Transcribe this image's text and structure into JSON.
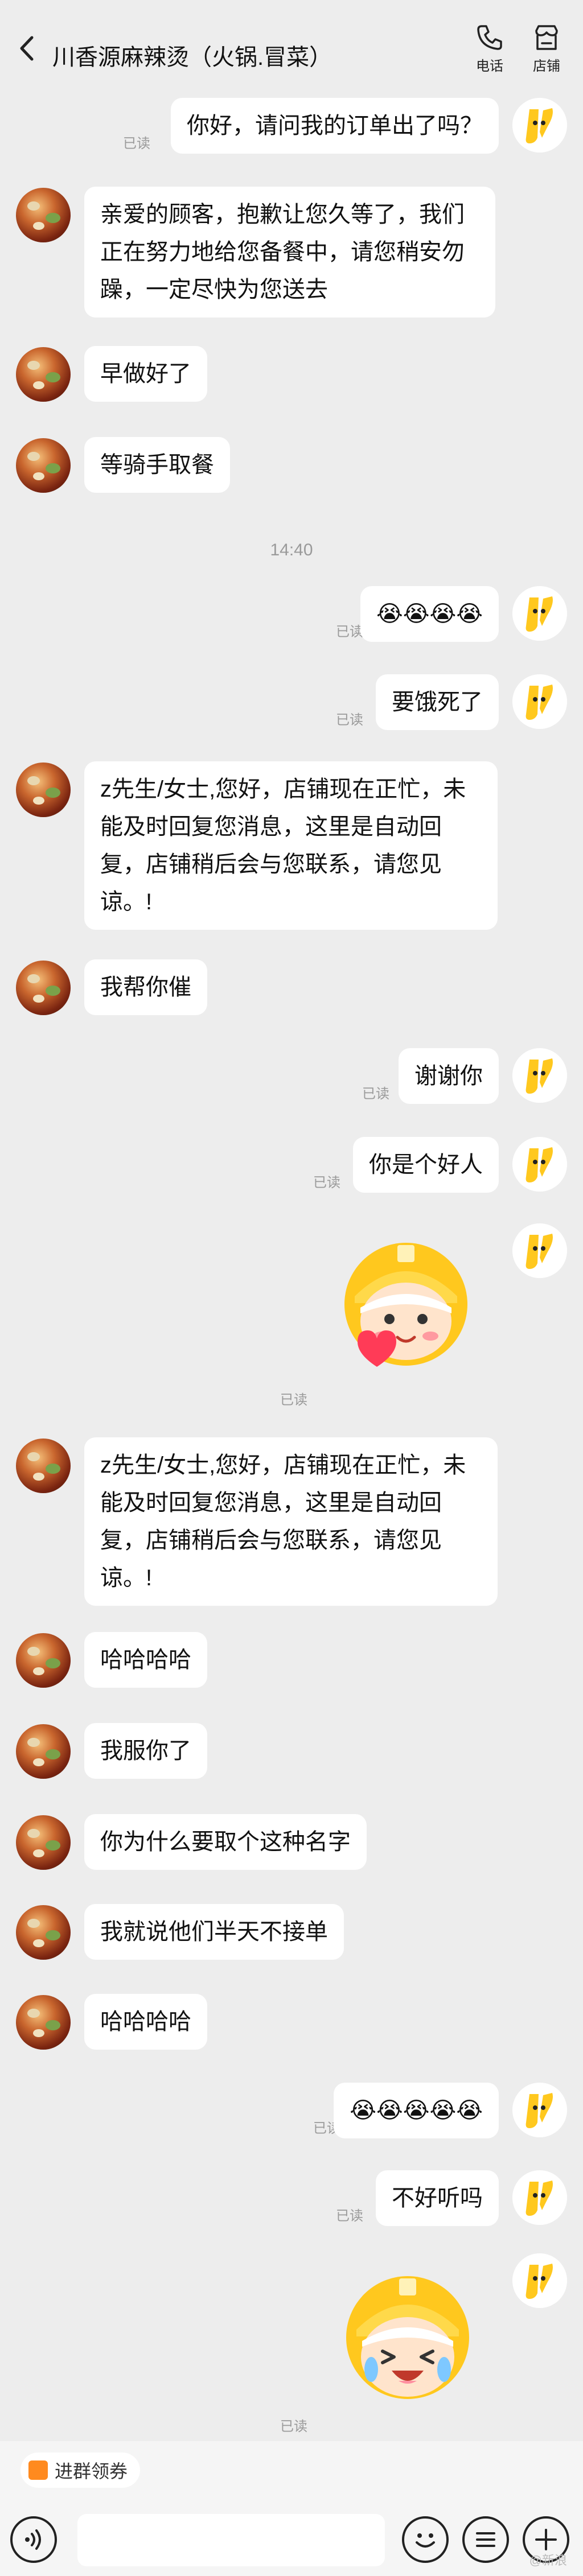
{
  "header": {
    "title": "川香源麻辣烫（火锅.冒菜）",
    "phone_label": "电话",
    "store_label": "店铺"
  },
  "messages": {
    "m1": {
      "text": "你好，请问我的订单出了吗？",
      "read": "已读"
    },
    "m2": {
      "text": "亲爱的顾客，抱歉让您久等了，我们正在努力地给您备餐中，请您稍安勿躁，一定尽快为您送去"
    },
    "m3": {
      "text": "早做好了"
    },
    "m4": {
      "text": "等骑手取餐"
    },
    "time1": "14:40",
    "m5": {
      "text": "😭😭😭😭",
      "read": "已读"
    },
    "m6": {
      "text": "要饿死了",
      "read": "已读"
    },
    "m7": {
      "text": "z先生/女士,您好，店铺现在正忙，未能及时回复您消息，这里是自动回复，店铺稍后会与您联系，请您见谅。!"
    },
    "m8": {
      "text": "我帮你催"
    },
    "m9": {
      "text": "谢谢你",
      "read": "已读"
    },
    "m10": {
      "text": "你是个好人",
      "read": "已读"
    },
    "m11": {
      "sticker": "smiling-helmet-heart-sticker",
      "read": "已读"
    },
    "m12": {
      "text": "z先生/女士,您好，店铺现在正忙，未能及时回复您消息，这里是自动回复，店铺稍后会与您联系，请您见谅。!"
    },
    "m13": {
      "text": "哈哈哈哈"
    },
    "m14": {
      "text": "我服你了"
    },
    "m15": {
      "text": "你为什么要取个这种名字"
    },
    "m16": {
      "text": "我就说他们半天不接单"
    },
    "m17": {
      "text": "哈哈哈哈"
    },
    "m18": {
      "text": "😭😭😭😭😭",
      "read": "已读"
    },
    "m19": {
      "text": "不好听吗",
      "read": "已读"
    },
    "m20": {
      "sticker": "laughing-crying-helmet-sticker",
      "read": "已读"
    }
  },
  "footer": {
    "coupon_label": "进群领券",
    "watermark": "@新浪"
  },
  "colors": {
    "background": "#ededed",
    "bubble": "#ffffff",
    "helmet_yellow": "#ffc81e",
    "brand_orange": "#ff8a1f"
  }
}
